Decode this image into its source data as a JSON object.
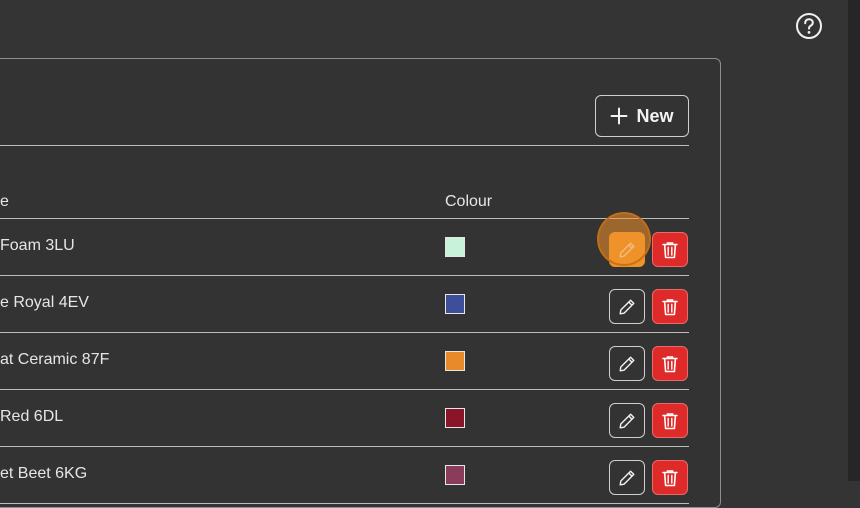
{
  "header": {
    "help_icon": "help-circle-icon"
  },
  "toolbar": {
    "new_label": "New",
    "new_icon": "plus-icon"
  },
  "table": {
    "columns": {
      "name_header": "e",
      "colour_header": "Colour"
    },
    "rows": [
      {
        "name": "Foam 3LU",
        "colour": "#c8f2d9",
        "edit_active": true
      },
      {
        "name": "e Royal 4EV",
        "colour": "#3e4f9a",
        "edit_active": false
      },
      {
        "name": "at Ceramic 87F",
        "colour": "#e8892a",
        "edit_active": false
      },
      {
        "name": "Red 6DL",
        "colour": "#8a1528",
        "edit_active": false
      },
      {
        "name": "et Beet 6KG",
        "colour": "#8a3d5a",
        "edit_active": false
      }
    ],
    "edit_icon": "pencil-icon",
    "delete_icon": "trash-icon"
  },
  "colors": {
    "accent_orange": "#f0922a",
    "danger_red": "#df2a2a",
    "background": "#343434"
  }
}
